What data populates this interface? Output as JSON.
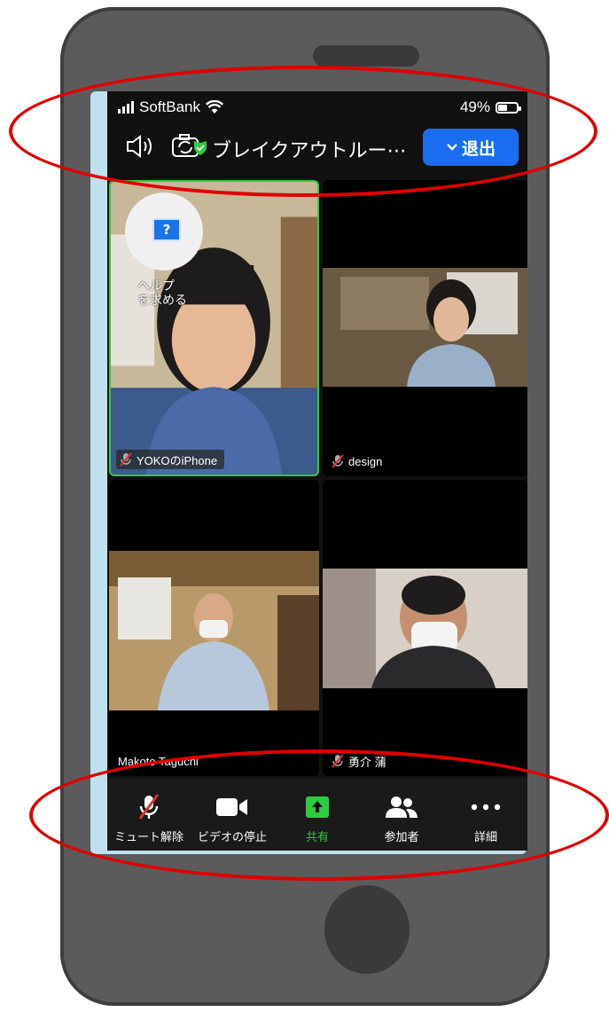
{
  "status_bar": {
    "carrier": "SoftBank",
    "battery": "49%",
    "battery_level": 0.49
  },
  "meeting_bar": {
    "title": "ブレイクアウトルー⋯",
    "leave_label": "退出",
    "leave_color": "#1a6df0"
  },
  "tiles": [
    {
      "name": "YOKOのiPhone",
      "muted": true,
      "active_speaker": true
    },
    {
      "name": "design",
      "muted": true
    },
    {
      "name": "Makoto Taguchi",
      "muted": false
    },
    {
      "name": "勇介 蒲",
      "muted": true
    }
  ],
  "help_button": {
    "label_line1": "ヘルプ",
    "label_line2": "を求める",
    "icon": "question-mark-icon"
  },
  "toolbar": {
    "unmute_label": "ミュート解除",
    "stop_video_label": "ビデオの停止",
    "share_label": "共有",
    "participants_label": "参加者",
    "more_label": "詳細",
    "share_color": "#2ecc40"
  },
  "annotation_color": "#e00000"
}
